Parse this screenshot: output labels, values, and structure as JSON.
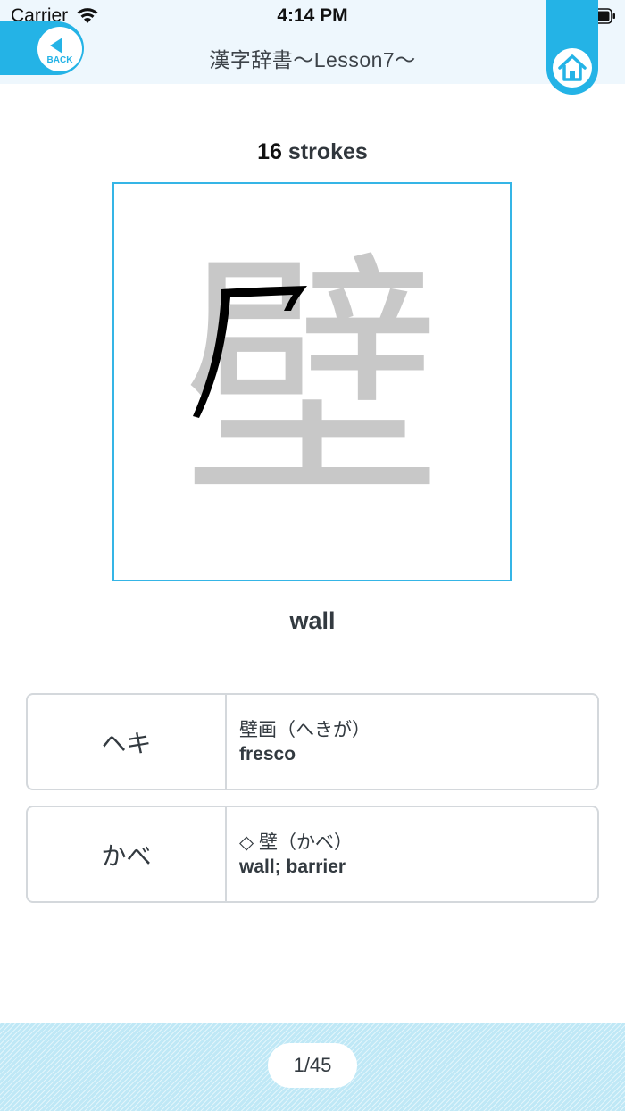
{
  "status_bar": {
    "carrier": "Carrier",
    "time": "4:14 PM"
  },
  "nav": {
    "title": "漢字辞書〜Lesson7〜",
    "back_label": "BACK",
    "accent_color": "#24b3e6"
  },
  "kanji": {
    "character": "壁",
    "stroke_count": "16",
    "stroke_label": " strokes",
    "meaning": "wall"
  },
  "readings": [
    {
      "reading": "ヘキ",
      "example": "壁画（へきが）",
      "example_en": "fresco"
    },
    {
      "reading": "かべ",
      "example": "◇ 壁（かべ）",
      "example_en": "wall; barrier"
    }
  ],
  "footer": {
    "page": "1/45"
  }
}
